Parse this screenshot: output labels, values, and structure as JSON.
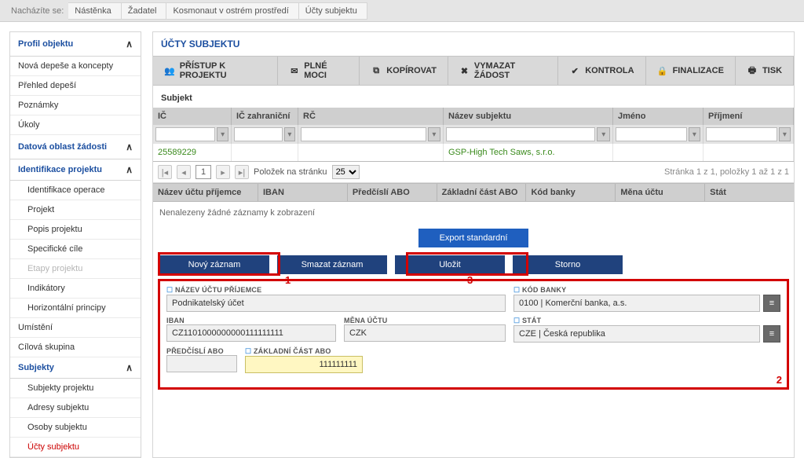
{
  "breadcrumb": {
    "label": "Nacházíte se:",
    "items": [
      "Nástěnka",
      "Žadatel",
      "Kosmonaut v ostrém prostředí",
      "Účty subjektu"
    ]
  },
  "sidebar": {
    "profil": "Profil objektu",
    "items_top": [
      "Nová depeše a koncepty",
      "Přehled depeší",
      "Poznámky",
      "Úkoly"
    ],
    "datova": "Datová oblast žádosti",
    "ident_hdr": "Identifikace projektu",
    "ident_items": [
      "Identifikace operace",
      "Projekt",
      "Popis projektu",
      "Specifické cíle",
      "Etapy projektu",
      "Indikátory",
      "Horizontální principy"
    ],
    "items_mid": [
      "Umístění",
      "Cílová skupina"
    ],
    "subjekty_hdr": "Subjekty",
    "subjekty_items": [
      "Subjekty projektu",
      "Adresy subjektu",
      "Osoby subjektu",
      "Účty subjektu"
    ]
  },
  "main": {
    "title": "ÚČTY SUBJEKTU",
    "toolbar": [
      "PŘÍSTUP K PROJEKTU",
      "PLNÉ MOCI",
      "KOPÍROVAT",
      "VYMAZAT ŽÁDOST",
      "KONTROLA",
      "FINALIZACE",
      "TISK"
    ],
    "section1": "Subjekt",
    "grid1_headers": [
      "IČ",
      "IČ zahraniční",
      "RČ",
      "Název subjektu",
      "Jméno",
      "Příjmení"
    ],
    "grid1_row": {
      "ic": "25589229",
      "icz": "",
      "rc": "",
      "naz": "GSP-High Tech Saws, s.r.o.",
      "jm": "",
      "pr": ""
    },
    "pager": {
      "items_label": "Položek na stránku",
      "page_size": "25",
      "summary": "Stránka 1 z 1, položky 1 až 1 z 1",
      "page": "1"
    },
    "grid2_headers": [
      "Název účtu příjemce",
      "IBAN",
      "Předčíslí ABO",
      "Základní část ABO",
      "Kód banky",
      "Měna účtu",
      "Stát"
    ],
    "no_records": "Nenalezeny žádné záznamy k zobrazení",
    "export_btn": "Export standardní",
    "action_btns": [
      "Nový záznam",
      "Smazat záznam",
      "Uložit",
      "Storno"
    ],
    "annotations": {
      "n1": "1",
      "n2": "2",
      "n3": "3"
    },
    "form": {
      "nazev_label": "NÁZEV ÚČTU PŘÍJEMCE",
      "nazev": "Podnikatelský účet",
      "kod_label": "KÓD BANKY",
      "kod": "0100 | Komerční banka, a.s.",
      "iban_label": "IBAN",
      "iban": "CZ1101000000000111111111",
      "mena_label": "MĚNA ÚČTU",
      "mena": "CZK",
      "stat_label": "STÁT",
      "stat": "CZE | Česká republika",
      "predcisli_label": "PŘEDČÍSLÍ ABO",
      "predcisli": "",
      "zakladni_label": "ZÁKLADNÍ ČÁST ABO",
      "zakladni": "111111111"
    }
  }
}
